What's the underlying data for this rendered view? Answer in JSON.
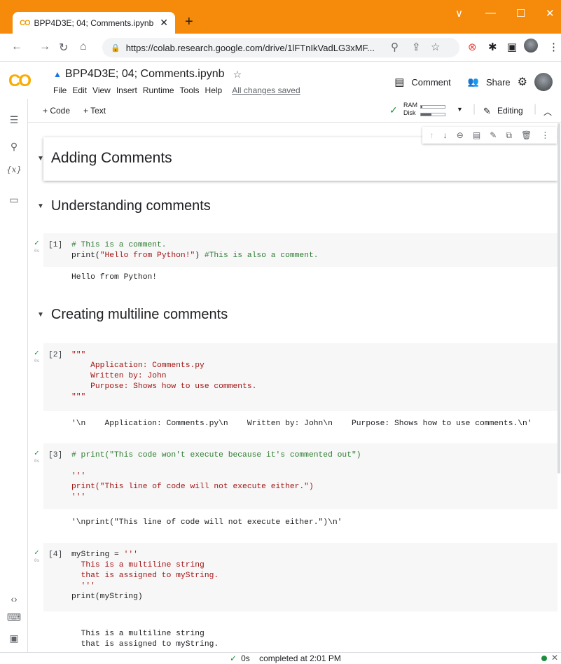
{
  "browser": {
    "tab_title": "BPP4D3E; 04; Comments.ipynb -",
    "tab_favicon": "CO",
    "new_tab": "+",
    "url": "https://colab.research.google.com/drive/1lFTnIkVadLG3xMF...",
    "window_controls": {
      "dropdown": "∨",
      "minimize": "—",
      "maximize": "☐",
      "close": "✕"
    }
  },
  "colab": {
    "logo": "CO",
    "notebook_title": "BPP4D3E; 04; Comments.ipynb",
    "menus": [
      "File",
      "Edit",
      "View",
      "Insert",
      "Runtime",
      "Tools",
      "Help"
    ],
    "save_status": "All changes saved",
    "comment_label": "Comment",
    "share_label": "Share",
    "toolbar": {
      "add_code": "+ Code",
      "add_text": "+ Text",
      "ram_label": "RAM",
      "disk_label": "Disk",
      "ram_fill": 0.05,
      "disk_fill": 0.45,
      "editing_label": "Editing"
    }
  },
  "notebook": {
    "sections": {
      "adding": "Adding Comments",
      "understanding": "Understanding comments",
      "multiline": "Creating multiline comments"
    },
    "cells": [
      {
        "num": "[1]",
        "lines": [
          "# This is a comment.",
          "print(\"Hello from Python!\") #This is also a comment."
        ],
        "output": "Hello from Python!"
      },
      {
        "num": "[2]",
        "lines": [
          "\"\"\"",
          "    Application: Comments.py",
          "    Written by: John",
          "    Purpose: Shows how to use comments.",
          "\"\"\""
        ],
        "output": "'\\n    Application: Comments.py\\n    Written by: John\\n    Purpose: Shows how to use comments.\\n'"
      },
      {
        "num": "[3]",
        "lines": [
          "# print(\"This code won't execute because it's commented out\")",
          "",
          "'''",
          "print(\"This line of code will not execute either.\")",
          "'''"
        ],
        "output": "'\\nprint(\"This line of code will not execute either.\")\\n'"
      },
      {
        "num": "[4]",
        "lines": [
          "myString = '''",
          "  This is a multiline string",
          "  that is assigned to myString.",
          "  '''",
          "print(myString)"
        ],
        "output": "  This is a multiline string\n  that is assigned to myString."
      }
    ],
    "run_marker": "0s"
  },
  "status": {
    "duration": "0s",
    "message": "completed at 2:01 PM"
  }
}
